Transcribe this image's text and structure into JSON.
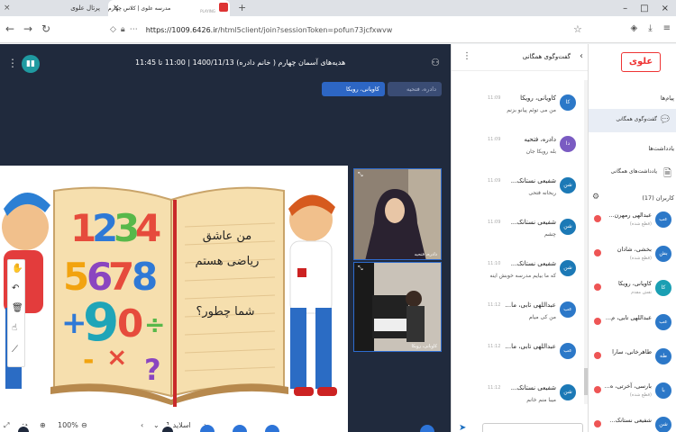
{
  "browser": {
    "inactive_tab_label": "پرتال علوی",
    "active_tab_title": "مدرسه علوی | کلاس چهارم",
    "active_tab_status": "PLAYING",
    "address_url_host": "https://1009.6426.ir",
    "address_url_path": "/html5client/join?sessionToken=pofun73jcfxwvw"
  },
  "session": {
    "title": "هدیه‌های آسمان چهارم ( خانم دادره) 1400/11/13 | 11:00 تا 11:45",
    "presenters": [
      "دادره، فتحیه",
      "کاویانی، رویکا"
    ]
  },
  "slide": {
    "heading_line1": "من عاشق",
    "heading_line2": "ریاضی هستم",
    "question": "شما چطور؟",
    "numbers": [
      "1",
      "2",
      "3",
      "4",
      "5",
      "6",
      "7",
      "8",
      "9",
      "0",
      "+",
      "-",
      "÷",
      "×",
      "?"
    ],
    "footer_slide_label": "اسلاید 1",
    "footer_zoom": "100%"
  },
  "videos": [
    {
      "label": "دادره، فتحیه"
    },
    {
      "label": "کاویانی، رویکا"
    }
  ],
  "chat": {
    "title": "گفت‌وگوی همگانی",
    "messages": [
      {
        "initials": "کا",
        "name": "کاویانی، رویکا",
        "time": "11:09",
        "text": "من می توئم پیانو بزنم",
        "color": "#2c78c8"
      },
      {
        "initials": "دا",
        "name": "دادره، فتحیه",
        "time": "11:09",
        "text": "بله رویکا جان",
        "color": "#7a5bc2"
      },
      {
        "initials": "شن",
        "name": "شفیعی نستانک...",
        "time": "11:09",
        "text": "ریحانه فتحی",
        "color": "#1c79b6"
      },
      {
        "initials": "شن",
        "name": "شفیعی نستانک...",
        "time": "11:09",
        "text": "چشم",
        "color": "#1c79b6"
      },
      {
        "initials": "شن",
        "name": "شفیعی نستانک...",
        "time": "11:10",
        "text": "که ما بیایم مدرسه خوبش اینه",
        "color": "#1c79b6"
      },
      {
        "initials": "عب",
        "name": "عبداللهی تابی، ما...",
        "time": "11:12",
        "text": "من کی میام",
        "color": "#2c78c8"
      },
      {
        "initials": "عب",
        "name": "عبداللهی تابی، ما...",
        "time": "11:12",
        "text": "",
        "color": "#2c78c8"
      },
      {
        "initials": "شن",
        "name": "شفیعی نستانک...",
        "time": "11:12",
        "text": "میبا منم خانم",
        "color": "#1c79b6"
      }
    ]
  },
  "sidebar": {
    "logo_text": "علوی",
    "sections": {
      "messages": "پیام‌ها",
      "notes": "یادداشت‌ها",
      "users": "کاربران (17)"
    },
    "chat_item": "گفت‌وگوی همگانی",
    "notes_item": "یادداشت‌های همگانی",
    "users": [
      {
        "initials": "عب",
        "name": "عبدالهی رمهرن...",
        "status": "(قطع شده)",
        "color": "#2c78c8"
      },
      {
        "initials": "بش",
        "name": "بخشی، شادان",
        "status": "(قطع شده)",
        "color": "#2c78c8"
      },
      {
        "initials": "کا",
        "name": "کاویانی، رویکا",
        "status": "تقش مقدم",
        "color": "#1a9fb3"
      },
      {
        "initials": "عب",
        "name": "عبداللهی تابی، م...",
        "status": "",
        "color": "#2c78c8"
      },
      {
        "initials": "طه",
        "name": "طاهرخانی، سارا",
        "status": "",
        "color": "#2c78c8"
      },
      {
        "initials": "با",
        "name": "بارسی، آخرتی، ه...",
        "status": "(قطع شده)",
        "color": "#2c78c8"
      },
      {
        "initials": "شن",
        "name": "شفیعی نستانک...",
        "status": "",
        "color": "#2c78c8"
      }
    ]
  }
}
